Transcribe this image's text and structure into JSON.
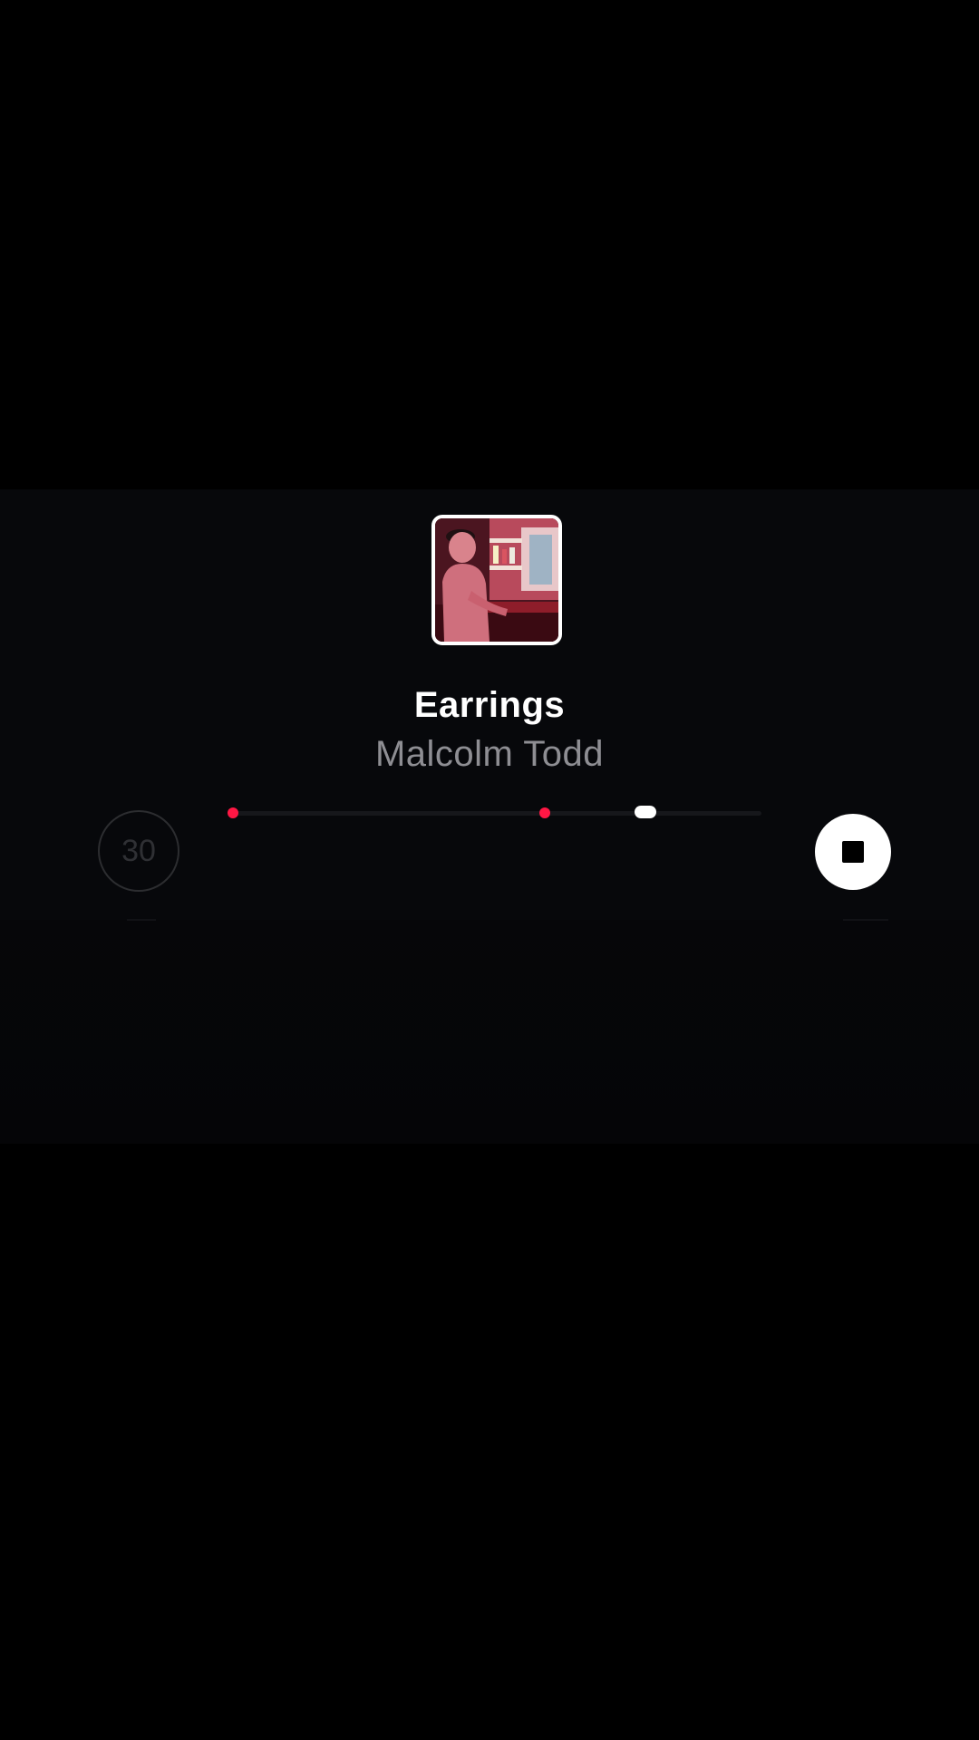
{
  "track": {
    "title": "Earrings",
    "artist": "Malcolm Todd",
    "artwork_icon": "album-artwork-photo"
  },
  "controls": {
    "skip_label": "30",
    "skip_icon": "skip-30-icon",
    "stop_icon": "stop-icon"
  },
  "scrubber": {
    "progress": 0.78,
    "markers": [
      0.0,
      0.59
    ]
  },
  "colors": {
    "background": "#000000",
    "sheet": "#07080b",
    "accent_marker": "#ff1744",
    "title": "#ffffff",
    "subtitle": "#8e8e93"
  }
}
